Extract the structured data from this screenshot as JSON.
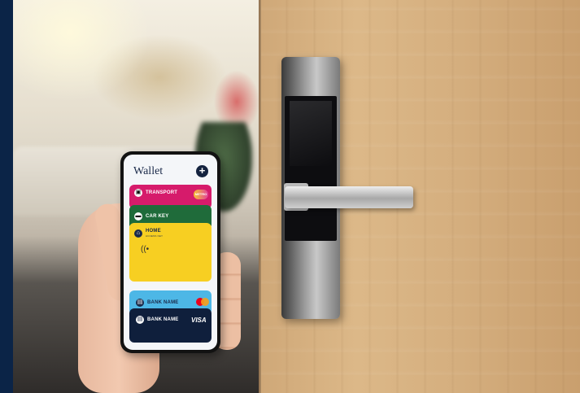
{
  "wallet": {
    "title": "Wallet",
    "add_symbol": "+",
    "cards": [
      {
        "label": "TRANSPORT",
        "badge": "METRO",
        "color": "#d61b6b"
      },
      {
        "label": "CAR KEY",
        "color": "#1f6b3a"
      },
      {
        "label": "HOME",
        "sublabel": "ACCESS KEY",
        "color": "#f7cf22"
      },
      {
        "label": "BANK NAME",
        "network": "mastercard-icon",
        "color": "#4db7e6"
      },
      {
        "label": "BANK NAME",
        "network_label": "VISA",
        "color": "#0f1f3c"
      }
    ]
  },
  "colors": {
    "accent_navy": "#0b2447",
    "door_wood": "#d5af7f",
    "lock_black": "#0d0d10"
  }
}
